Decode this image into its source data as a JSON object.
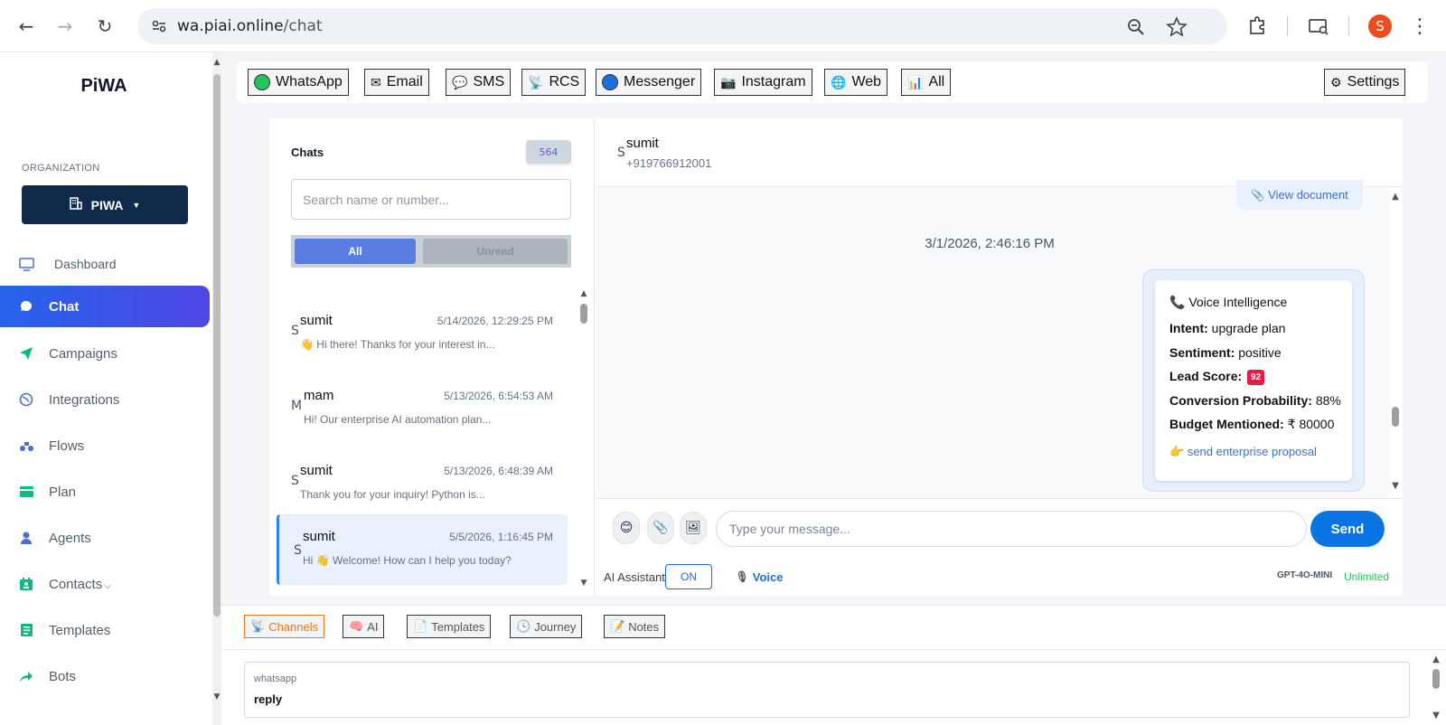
{
  "browser": {
    "url_host": "wa.piai.online",
    "url_path": "/chat",
    "profile_initial": "S"
  },
  "sidebar": {
    "brand": "PiWA",
    "org_label": "ORGANIZATION",
    "org_name": "PIWA",
    "items": [
      {
        "label": "Dashboard",
        "icon": "monitor-icon"
      },
      {
        "label": "Chat",
        "icon": "chat-bubble-icon"
      },
      {
        "label": "Campaigns",
        "icon": "paper-plane-icon"
      },
      {
        "label": "Integrations",
        "icon": "globe-icon"
      },
      {
        "label": "Flows",
        "icon": "flow-icon"
      },
      {
        "label": "Plan",
        "icon": "card-icon"
      },
      {
        "label": "Agents",
        "icon": "person-icon"
      },
      {
        "label": "Contacts",
        "icon": "contacts-icon"
      },
      {
        "label": "Templates",
        "icon": "template-icon"
      },
      {
        "label": "Bots",
        "icon": "share-arrow-icon"
      }
    ]
  },
  "channels": {
    "whatsapp": "WhatsApp",
    "email": "Email",
    "sms": "SMS",
    "rcs": "RCS",
    "messenger": "Messenger",
    "instagram": "Instagram",
    "web": "Web",
    "all": "All",
    "settings": "Settings"
  },
  "chats": {
    "title": "Chats",
    "count": "564",
    "search_placeholder": "Search name or number...",
    "filter_all": "All",
    "filter_unread": "Unread",
    "items": [
      {
        "initial": "S",
        "name": "sumit",
        "time": "5/14/2026, 12:29:25 PM",
        "preview": "👋 Hi there! Thanks for your interest in..."
      },
      {
        "initial": "M",
        "name": "mam",
        "time": "5/13/2026, 6:54:53 AM",
        "preview": "Hi! Our enterprise AI automation plan..."
      },
      {
        "initial": "S",
        "name": "sumit",
        "time": "5/13/2026, 6:48:39 AM",
        "preview": "Thank you for your inquiry! Python is..."
      },
      {
        "initial": "S",
        "name": "sumit",
        "time": "5/5/2026, 1:16:45 PM",
        "preview": "Hi 👋 Welcome! How can I help you today?"
      }
    ]
  },
  "conversation": {
    "initial": "S",
    "name": "sumit",
    "phone": "+919766912001",
    "view_document": "View document",
    "timestamp": "3/1/2026, 2:46:16 PM",
    "voice_card": {
      "title": "Voice Intelligence",
      "intent_label": "Intent:",
      "intent": "upgrade plan",
      "sentiment_label": "Sentiment:",
      "sentiment": "positive",
      "lead_label": "Lead Score:",
      "lead_score": "92",
      "conversion_label": "Conversion Probability:",
      "conversion": "88%",
      "budget_label": "Budget Mentioned:",
      "budget": "₹ 80000",
      "action": "send enterprise proposal"
    },
    "message_placeholder": "Type your message...",
    "send": "Send",
    "ai_assistant": "AI Assistant",
    "ai_state": "ON",
    "voice": "Voice",
    "model": "GPT-4O-MINI",
    "plan": "Unlimited"
  },
  "bottom_tabs": {
    "channels": "Channels",
    "ai": "AI",
    "templates": "Templates",
    "journey": "Journey",
    "notes": "Notes"
  },
  "channel_field": {
    "label": "whatsapp",
    "value": "reply"
  },
  "colors": {
    "accent": "#2563eb",
    "active_nav_end": "#4f46e5",
    "org_button": "#0f2a4a",
    "send": "#0b74e5",
    "lead_badge": "#e11d48",
    "plan_green": "#22c55e",
    "tab_active": "#f97316"
  }
}
